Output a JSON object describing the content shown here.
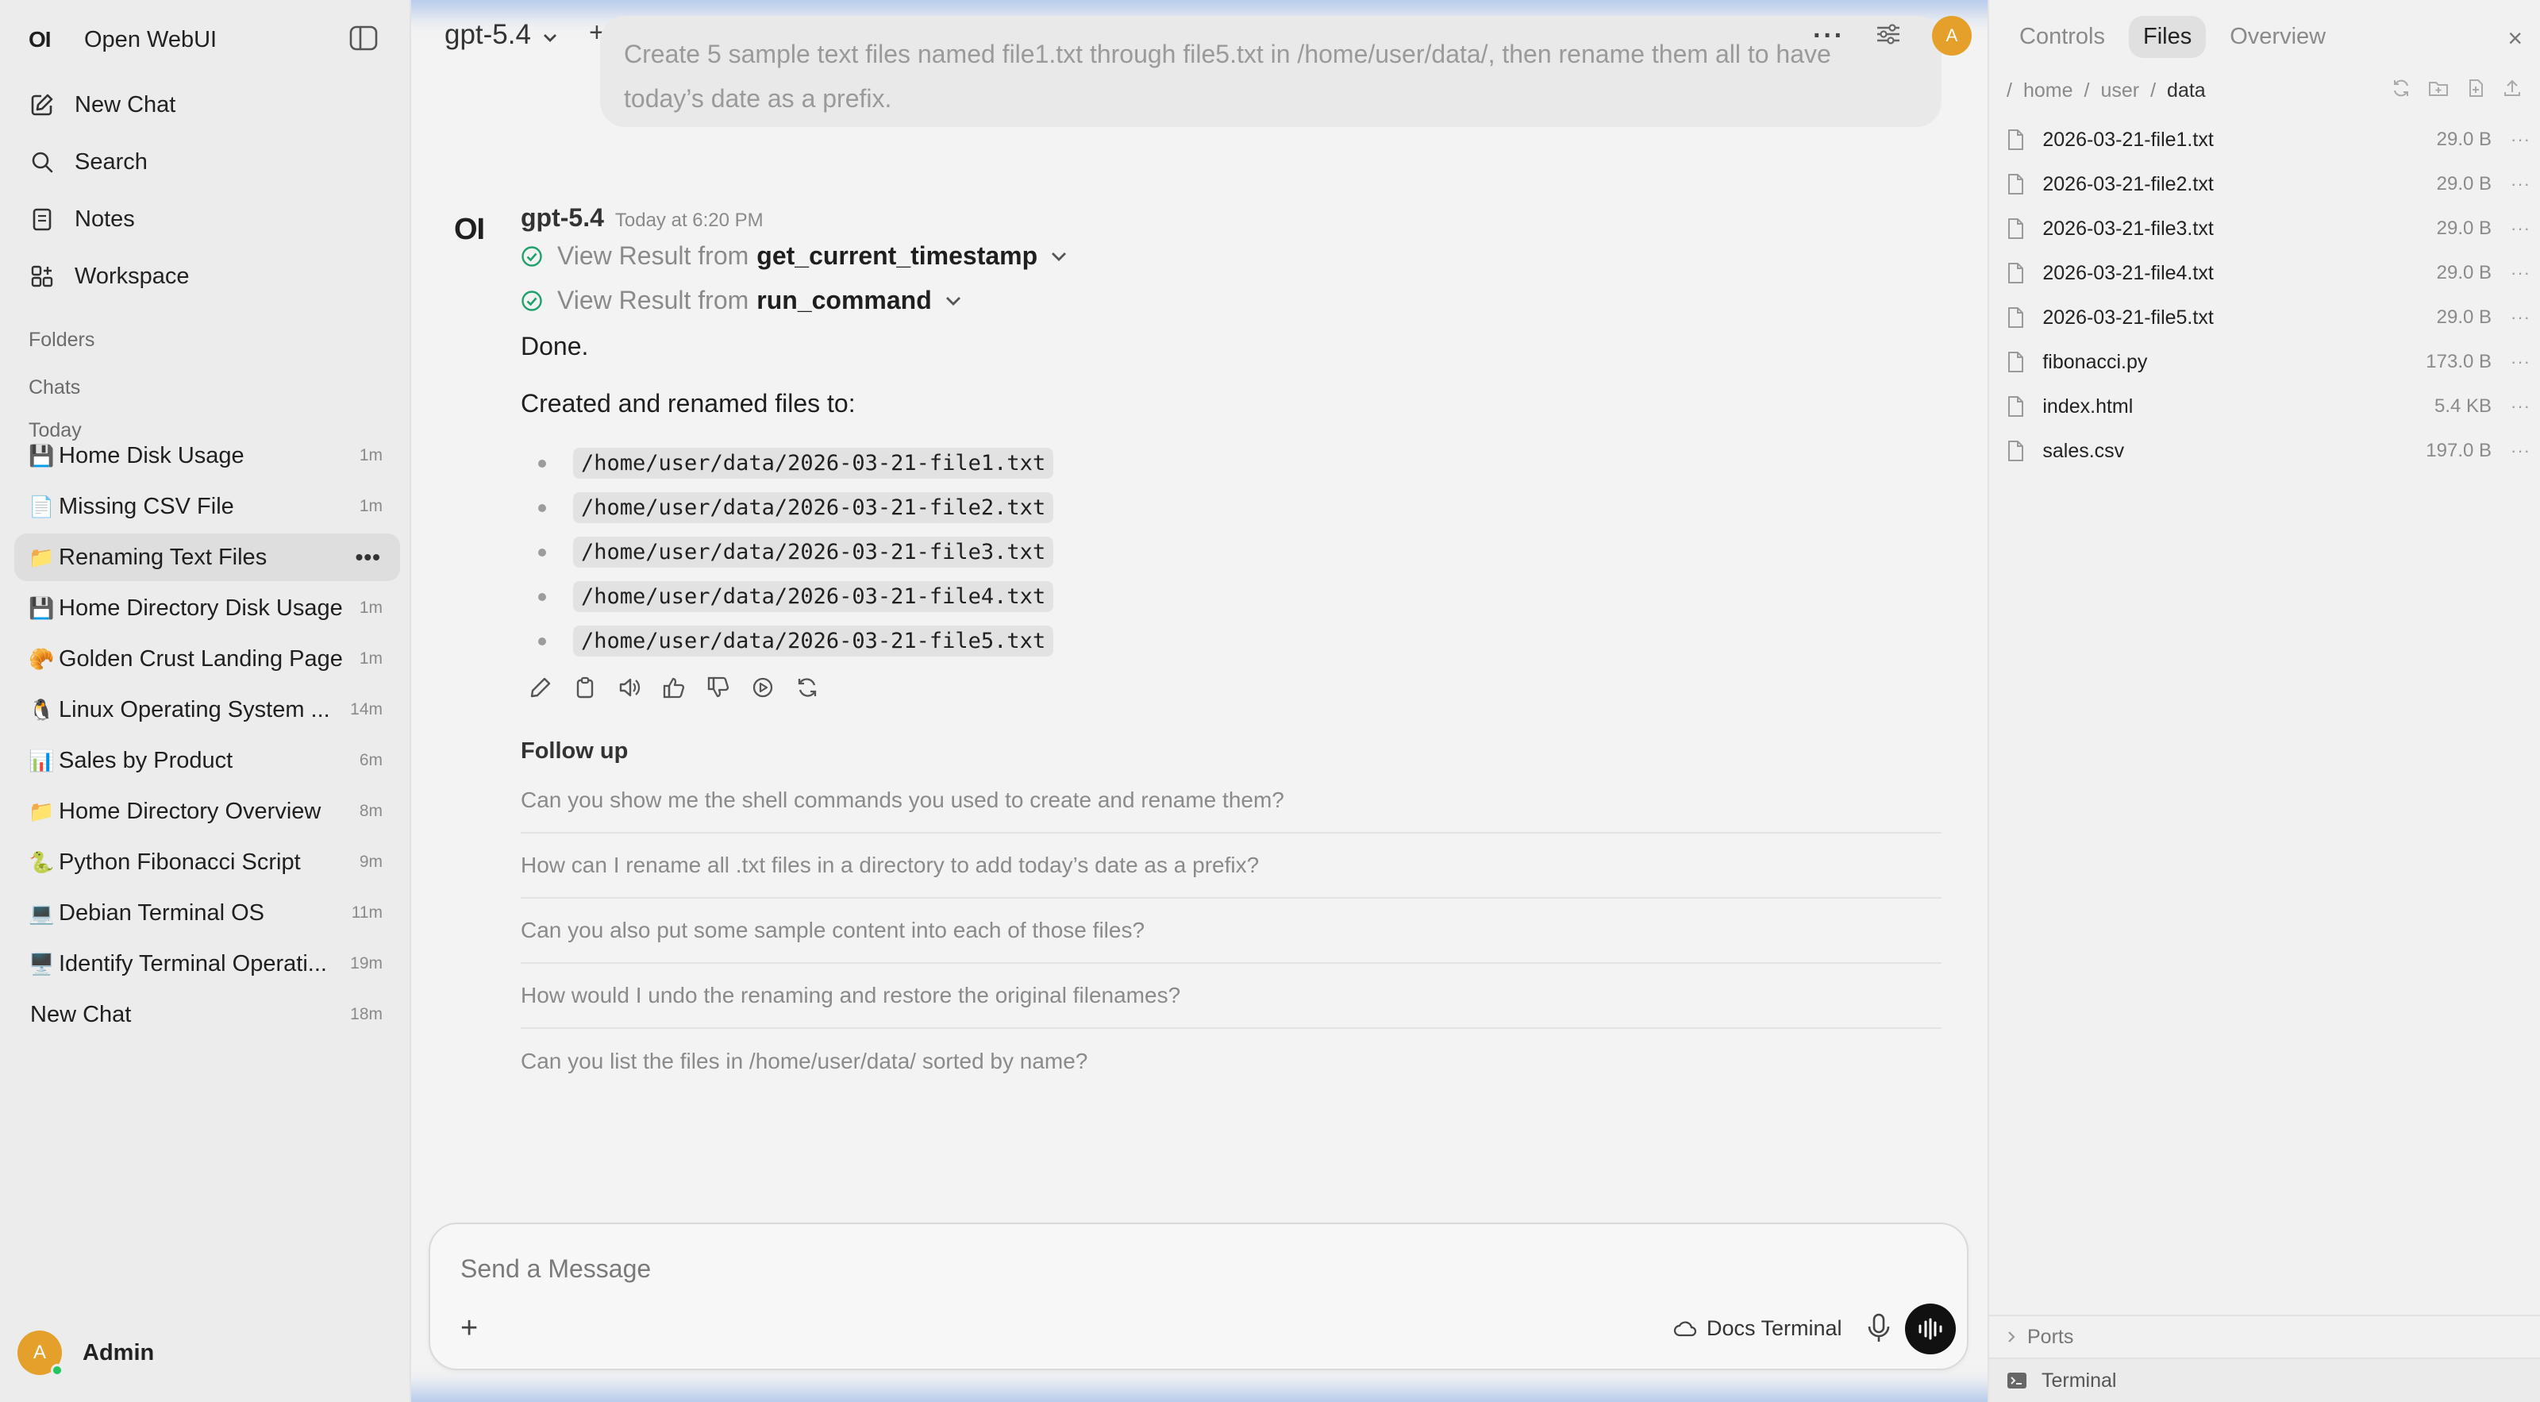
{
  "app": {
    "logo": "OI",
    "name": "Open WebUI"
  },
  "nav": [
    {
      "label": "New Chat",
      "icon": "pencil-square-icon"
    },
    {
      "label": "Search",
      "icon": "search-icon"
    },
    {
      "label": "Notes",
      "icon": "notes-icon"
    },
    {
      "label": "Workspace",
      "icon": "workspace-icon"
    }
  ],
  "sections": {
    "folders": "Folders",
    "chats": "Chats",
    "today": "Today"
  },
  "chats": [
    {
      "emoji": "💾",
      "title": "Home Disk Usage",
      "time": "1m"
    },
    {
      "emoji": "📄",
      "title": "Missing CSV File",
      "time": "1m"
    },
    {
      "emoji": "📁",
      "title": "Renaming Text Files",
      "time": "",
      "more": "•••",
      "active": true
    },
    {
      "emoji": "💾",
      "title": "Home Directory Disk Usage",
      "time": "1m"
    },
    {
      "emoji": "🥐",
      "title": "Golden Crust Landing Page",
      "time": "1m"
    },
    {
      "emoji": "🐧",
      "title": "Linux Operating System ...",
      "time": "14m"
    },
    {
      "emoji": "📊",
      "title": "Sales by Product",
      "time": "6m"
    },
    {
      "emoji": "📁",
      "title": "Home Directory Overview",
      "time": "8m"
    },
    {
      "emoji": "🐍",
      "title": "Python Fibonacci Script",
      "time": "9m"
    },
    {
      "emoji": "💻",
      "title": "Debian Terminal OS",
      "time": "11m"
    },
    {
      "emoji": "🖥️",
      "title": "Identify Terminal Operati...",
      "time": "19m"
    },
    {
      "emoji": "",
      "title": "New Chat",
      "time": "18m"
    }
  ],
  "user": {
    "initial": "A",
    "name": "Admin",
    "avatar_color": "#e4a02a"
  },
  "header": {
    "model": "gpt-5.4",
    "plus": "+",
    "more": "···"
  },
  "user_message": "Create 5 sample text files named file1.txt through file5.txt in /home/user/data/, then rename them all to have today’s date as a prefix.",
  "assistant": {
    "logo": "OI",
    "name": "gpt-5.4",
    "time": "Today at 6:20 PM",
    "tools": [
      {
        "prefix": "View Result from",
        "name": "get_current_timestamp"
      },
      {
        "prefix": "View Result from",
        "name": "run_command"
      }
    ],
    "done": "Done.",
    "created": "Created and renamed files to:",
    "files": [
      "/home/user/data/2026-03-21-file1.txt",
      "/home/user/data/2026-03-21-file2.txt",
      "/home/user/data/2026-03-21-file3.txt",
      "/home/user/data/2026-03-21-file4.txt",
      "/home/user/data/2026-03-21-file5.txt"
    ]
  },
  "follow_up": {
    "title": "Follow up",
    "items": [
      "Can you show me the shell commands you used to create and rename them?",
      "How can I rename all .txt files in a directory to add today’s date as a prefix?",
      "Can you also put some sample content into each of those files?",
      "How would I undo the renaming and restore the original filenames?",
      "Can you list the files in /home/user/data/ sorted by name?"
    ]
  },
  "composer": {
    "placeholder": "Send a Message",
    "plus": "+",
    "docs_terminal": "Docs Terminal"
  },
  "panel": {
    "tabs": [
      "Controls",
      "Files",
      "Overview"
    ],
    "active_tab": "Files",
    "close": "×",
    "breadcrumb": [
      "/",
      "home",
      "/",
      "user",
      "/",
      "data"
    ],
    "files": [
      {
        "name": "2026-03-21-file1.txt",
        "size": "29.0 B"
      },
      {
        "name": "2026-03-21-file2.txt",
        "size": "29.0 B"
      },
      {
        "name": "2026-03-21-file3.txt",
        "size": "29.0 B"
      },
      {
        "name": "2026-03-21-file4.txt",
        "size": "29.0 B"
      },
      {
        "name": "2026-03-21-file5.txt",
        "size": "29.0 B"
      },
      {
        "name": "fibonacci.py",
        "size": "173.0 B"
      },
      {
        "name": "index.html",
        "size": "5.4 KB"
      },
      {
        "name": "sales.csv",
        "size": "197.0 B"
      }
    ],
    "file_more": "···",
    "ports": "Ports",
    "terminal": "Terminal"
  }
}
